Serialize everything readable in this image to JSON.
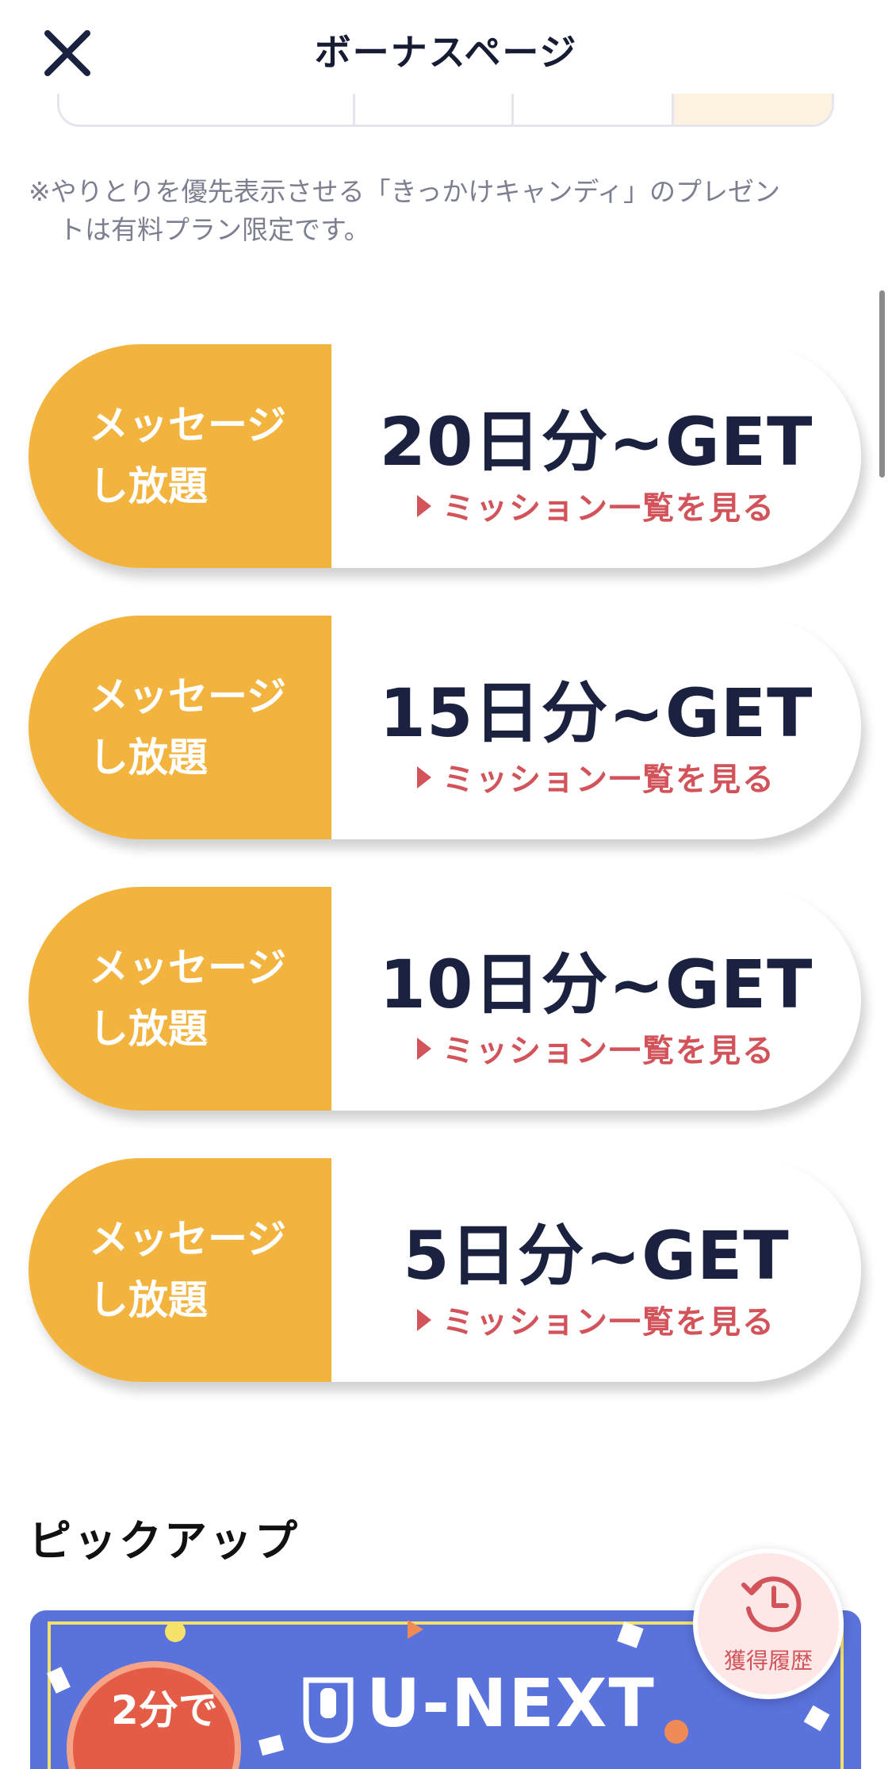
{
  "header": {
    "title": "ボーナスページ",
    "close_icon": "close-icon"
  },
  "notice": {
    "line1": "※やりとりを優先表示させる「きっかけキャンディ」のプレゼン",
    "line2": "トは有料プラン限定です。"
  },
  "cards": [
    {
      "label_line1": "メッセージ",
      "label_line2": "し放題",
      "amount": "20日分~GET",
      "link": "ミッション一覧を見る"
    },
    {
      "label_line1": "メッセージ",
      "label_line2": "し放題",
      "amount": "15日分~GET",
      "link": "ミッション一覧を見る"
    },
    {
      "label_line1": "メッセージ",
      "label_line2": "し放題",
      "amount": "10日分~GET",
      "link": "ミッション一覧を見る"
    },
    {
      "label_line1": "メッセージ",
      "label_line2": "し放題",
      "amount": "5日分~GET",
      "link": "ミッション一覧を見る"
    }
  ],
  "pickup": {
    "title": "ピックアップ",
    "banner": {
      "badge": "2分で",
      "brand": "U-NEXT"
    }
  },
  "fab": {
    "label": "獲得履歴",
    "icon": "history-clock-icon"
  },
  "colors": {
    "accent_yellow": "#f2b43f",
    "link_red": "#d2545a",
    "navy": "#1b2240",
    "banner_blue": "#5a72dc"
  }
}
